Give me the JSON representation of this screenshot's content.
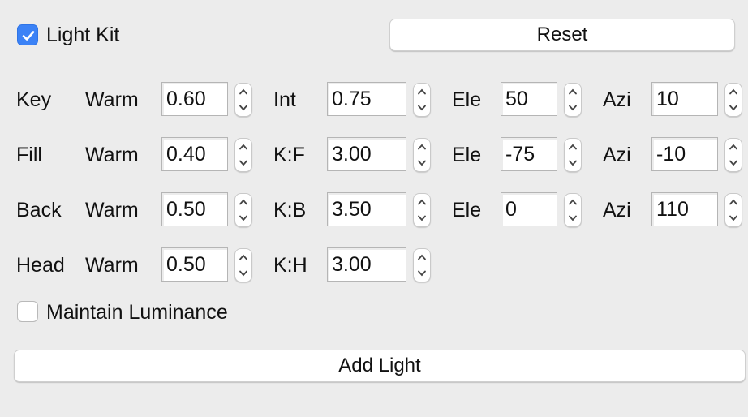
{
  "header": {
    "light_kit": {
      "label": "Light Kit",
      "checked": true
    },
    "reset_label": "Reset"
  },
  "rows": [
    {
      "name": "Key",
      "warm_label": "Warm",
      "warm": "0.60",
      "second_label": "Int",
      "second": "0.75",
      "ele_label": "Ele",
      "ele": "50",
      "azi_label": "Azi",
      "azi": "10"
    },
    {
      "name": "Fill",
      "warm_label": "Warm",
      "warm": "0.40",
      "second_label": "K:F",
      "second": "3.00",
      "ele_label": "Ele",
      "ele": "-75",
      "azi_label": "Azi",
      "azi": "-10"
    },
    {
      "name": "Back",
      "warm_label": "Warm",
      "warm": "0.50",
      "second_label": "K:B",
      "second": "3.50",
      "ele_label": "Ele",
      "ele": "0",
      "azi_label": "Azi",
      "azi": "110"
    },
    {
      "name": "Head",
      "warm_label": "Warm",
      "warm": "0.50",
      "second_label": "K:H",
      "second": "3.00"
    }
  ],
  "maintain_luminance": {
    "label": "Maintain Luminance",
    "checked": false
  },
  "add_light_label": "Add Light",
  "colors": {
    "accent": "#3b82f6",
    "background": "#ececec"
  }
}
